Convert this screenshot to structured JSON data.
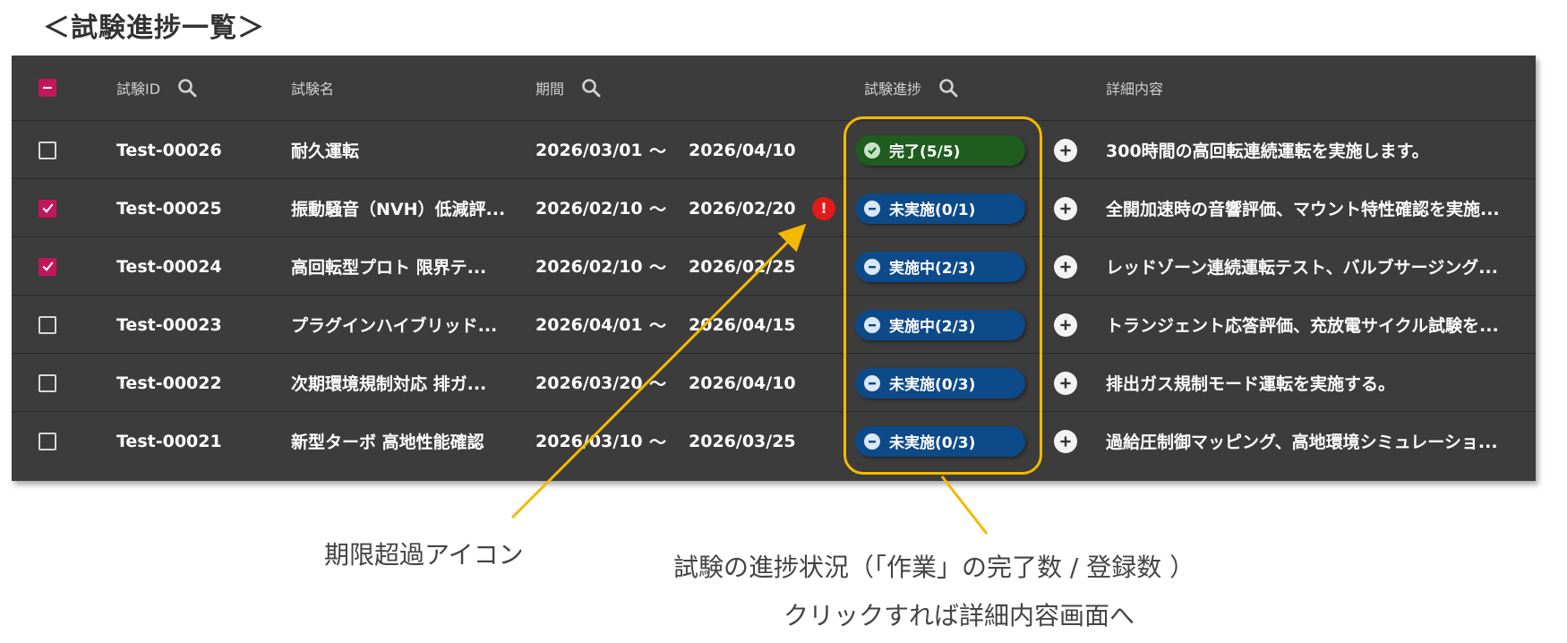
{
  "page_title": "＜試験進捗一覧＞",
  "columns": {
    "test_id": "試験ID",
    "test_name": "試験名",
    "period": "期間",
    "progress": "試験進捗",
    "detail": "詳細内容"
  },
  "period_separator": "〜",
  "rows": [
    {
      "id": "Test-00026",
      "name": "耐久運転",
      "from": "2026/03/01",
      "to": "2026/04/10",
      "progress": "完了(5/5)",
      "status": "complete",
      "detail": "300時間の高回転連続運転を実施します。",
      "checked": false,
      "overdue": false
    },
    {
      "id": "Test-00025",
      "name": "振動騒音（NVH）低減評...",
      "from": "2026/02/10",
      "to": "2026/02/20",
      "progress": "未実施(0/1)",
      "status": "pending",
      "detail": "全開加速時の音響評価、マウント特性確認を実施...",
      "checked": true,
      "overdue": true
    },
    {
      "id": "Test-00024",
      "name": "高回転型プロト 限界テ...",
      "from": "2026/02/10",
      "to": "2026/02/25",
      "progress": "実施中(2/3)",
      "status": "in_progress",
      "detail": "レッドゾーン連続運転テスト、バルブサージング...",
      "checked": true,
      "overdue": false
    },
    {
      "id": "Test-00023",
      "name": "プラグインハイブリッド...",
      "from": "2026/04/01",
      "to": "2026/04/15",
      "progress": "実施中(2/3)",
      "status": "in_progress",
      "detail": "トランジェント応答評価、充放電サイクル試験を...",
      "checked": false,
      "overdue": false
    },
    {
      "id": "Test-00022",
      "name": "次期環境規制対応 排ガ...",
      "from": "2026/03/20",
      "to": "2026/04/10",
      "progress": "未実施(0/3)",
      "status": "pending",
      "detail": "排出ガス規制モード運転を実施する。",
      "checked": false,
      "overdue": false
    },
    {
      "id": "Test-00021",
      "name": "新型ターボ 高地性能確認",
      "from": "2026/03/10",
      "to": "2026/03/25",
      "progress": "未実施(0/3)",
      "status": "pending",
      "detail": "過給圧制御マッピング、高地環境シミュレーショ...",
      "checked": false,
      "overdue": false
    }
  ],
  "overdue_glyph": "!",
  "annotations": {
    "overdue_icon": "期限超過アイコン",
    "progress_line1": "試験の進捗状況（「作業」の完了数 / 登録数 ）",
    "progress_line2": "クリックすれば詳細内容画面へ"
  },
  "colors": {
    "grid_bg": "#3c3c3c",
    "checkbox_checked": "#c2185b",
    "pill_complete": "#1f5c1f",
    "pill_pending": "#0d4a8a",
    "overdue": "#e11a1a",
    "annotation": "#f5b800"
  },
  "icons": {
    "search": "search-icon",
    "add": "plus-circle-icon",
    "overdue": "exclamation-circle-icon"
  }
}
